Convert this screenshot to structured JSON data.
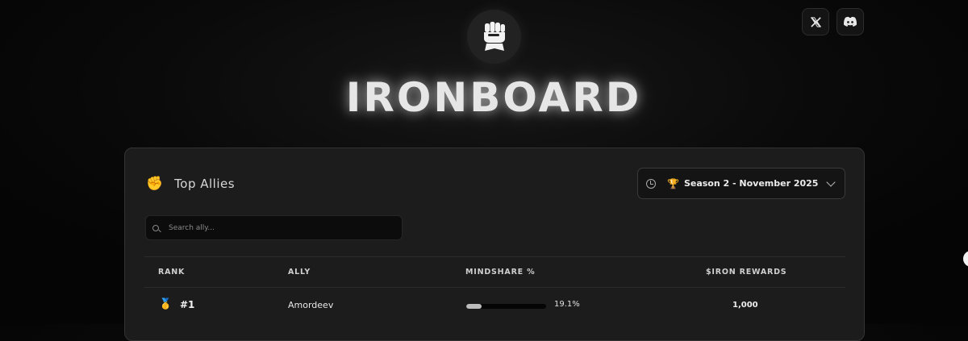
{
  "header": {
    "brand": "IRONBOARD",
    "logo_icon": "fist-gauntlet-icon"
  },
  "social": [
    {
      "name": "x-icon",
      "glyph": "𝕏"
    },
    {
      "name": "discord-icon",
      "glyph": ""
    }
  ],
  "panel": {
    "title_icon": "✊",
    "title": "Top Allies",
    "season": {
      "icon": "🏆",
      "label": "Season 2 - November 2025"
    },
    "search": {
      "placeholder": "Search ally...",
      "value": ""
    },
    "columns": {
      "rank": "RANK",
      "ally": "ALLY",
      "mindshare": "MINDSHARE %",
      "rewards": "$IRON REWARDS"
    },
    "rows": [
      {
        "medal": "🥇",
        "rank": "#1",
        "ally": "Amordeev",
        "mindshare": "19.1%",
        "mindshare_fraction": 0.191,
        "rewards": "1,000"
      }
    ]
  },
  "colors": {
    "accent": "#bdbdbd",
    "background": "#0a0a0a",
    "panel": "#1c1c1c"
  }
}
